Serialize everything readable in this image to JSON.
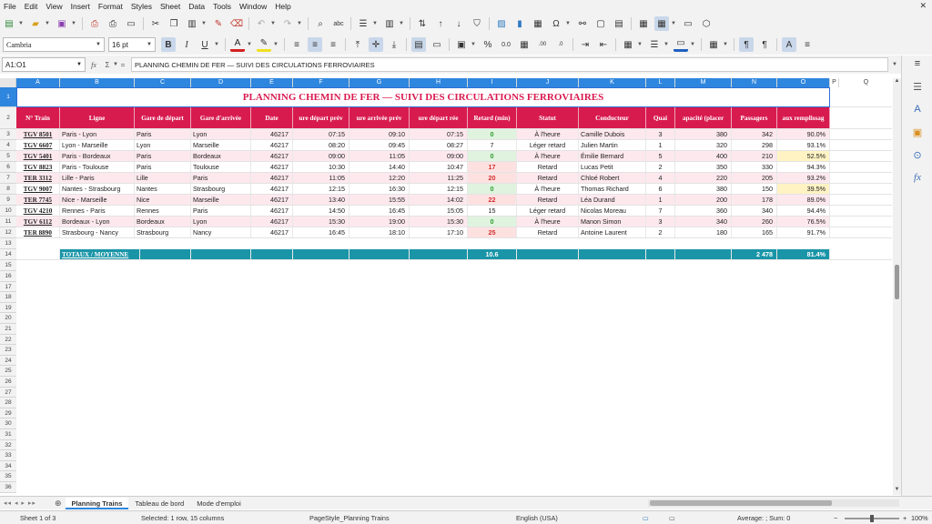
{
  "menu": [
    "File",
    "Edit",
    "View",
    "Insert",
    "Format",
    "Styles",
    "Sheet",
    "Data",
    "Tools",
    "Window",
    "Help"
  ],
  "toolbar": {
    "font_name": "Cambria",
    "font_size": "16 pt"
  },
  "formula_bar": {
    "name_box": "A1:O1",
    "fx": "fx",
    "sigma": "Σ",
    "equals": "=",
    "content": "PLANNING CHEMIN DE FER — SUIVI DES CIRCULATIONS FERROVIAIRES"
  },
  "columns": [
    "A",
    "B",
    "C",
    "D",
    "E",
    "F",
    "G",
    "H",
    "I",
    "J",
    "K",
    "L",
    "M",
    "N",
    "O",
    "P",
    "Q"
  ],
  "row_numbers": [
    "1",
    "2",
    "3",
    "4",
    "5",
    "6",
    "7",
    "8",
    "9",
    "10",
    "11",
    "12",
    "13",
    "14",
    "15",
    "16",
    "17",
    "18",
    "19",
    "20",
    "21",
    "22",
    "23",
    "24",
    "25",
    "26",
    "27",
    "28",
    "29",
    "30",
    "31",
    "32",
    "33",
    "34",
    "35",
    "36"
  ],
  "sheet": {
    "title": "PLANNING CHEMIN DE FER — SUIVI DES CIRCULATIONS FERROVIAIRES",
    "headers": [
      "N° Train",
      "Ligne",
      "Gare de départ",
      "Gare d'arrivée",
      "Date",
      "ure départ prév",
      "ure arrivée prév",
      "ure départ rée",
      "Retard (min)",
      "Statut",
      "Conducteur",
      "Quai",
      "apacité (placer",
      "Passagers",
      "aux remplissag"
    ],
    "rows": [
      [
        "TGV 8501",
        "Paris - Lyon",
        "Paris",
        "Lyon",
        "46217",
        "07:15",
        "09:10",
        "07:15",
        "0",
        "À l'heure",
        "Camille Dubois",
        "3",
        "380",
        "342",
        "90.0%"
      ],
      [
        "TGV 6607",
        "Lyon - Marseille",
        "Lyon",
        "Marseille",
        "46217",
        "08:20",
        "09:45",
        "08:27",
        "7",
        "Léger retard",
        "Julien Martin",
        "1",
        "320",
        "298",
        "93.1%"
      ],
      [
        "TGV 5401",
        "Paris - Bordeaux",
        "Paris",
        "Bordeaux",
        "46217",
        "09:00",
        "11:05",
        "09:00",
        "0",
        "À l'heure",
        "Émilie Bernard",
        "5",
        "400",
        "210",
        "52.5%"
      ],
      [
        "TGV 8823",
        "Paris - Toulouse",
        "Paris",
        "Toulouse",
        "46217",
        "10:30",
        "14:40",
        "10:47",
        "17",
        "Retard",
        "Lucas Petit",
        "2",
        "350",
        "330",
        "94.3%"
      ],
      [
        "TER 3312",
        "Lille - Paris",
        "Lille",
        "Paris",
        "46217",
        "11:05",
        "12:20",
        "11:25",
        "20",
        "Retard",
        "Chloé Robert",
        "4",
        "220",
        "205",
        "93.2%"
      ],
      [
        "TGV 9007",
        "Nantes - Strasbourg",
        "Nantes",
        "Strasbourg",
        "46217",
        "12:15",
        "16:30",
        "12:15",
        "0",
        "À l'heure",
        "Thomas Richard",
        "6",
        "380",
        "150",
        "39.5%"
      ],
      [
        "TER 7745",
        "Nice - Marseille",
        "Nice",
        "Marseille",
        "46217",
        "13:40",
        "15:55",
        "14:02",
        "22",
        "Retard",
        "Léa Durand",
        "1",
        "200",
        "178",
        "89.0%"
      ],
      [
        "TGV 4210",
        "Rennes - Paris",
        "Rennes",
        "Paris",
        "46217",
        "14:50",
        "16:45",
        "15:05",
        "15",
        "Léger retard",
        "Nicolas Moreau",
        "7",
        "360",
        "340",
        "94.4%"
      ],
      [
        "TGV 6112",
        "Bordeaux - Lyon",
        "Bordeaux",
        "Lyon",
        "46217",
        "15:30",
        "19:00",
        "15:30",
        "0",
        "À l'heure",
        "Manon Simon",
        "3",
        "340",
        "260",
        "76.5%"
      ],
      [
        "TER 8890",
        "Strasbourg - Nancy",
        "Strasbourg",
        "Nancy",
        "46217",
        "16:45",
        "18:10",
        "17:10",
        "25",
        "Retard",
        "Antoine Laurent",
        "2",
        "180",
        "165",
        "91.7%"
      ]
    ],
    "totals_label": "TOTAUX / MOYENNE",
    "total_delay": "10.6",
    "total_passengers": "2 478",
    "total_fill": "81.4%"
  },
  "tabs": [
    "Planning Trains",
    "Tableau de bord",
    "Mode d'emploi"
  ],
  "tab_add": "⊕",
  "status": {
    "sheet": "Sheet 1 of 3",
    "selection": "Selected: 1 row, 15 columns",
    "page_style": "PageStyle_Planning Trains",
    "language": "English (USA)",
    "summary": "Average: ; Sum: 0",
    "zoom": "100%"
  },
  "colors": {
    "header": "#d81b4f",
    "totals": "#1a95a8",
    "stripe": "#fde8ee",
    "delay_zero_bg": "#dff3df",
    "delay_zero_fg": "#2e9b2e",
    "delay_high_bg": "#fde1e1",
    "delay_high_fg": "#d32f2f",
    "fill_low_bg": "#fff3c4",
    "selection": "#2e86de"
  }
}
